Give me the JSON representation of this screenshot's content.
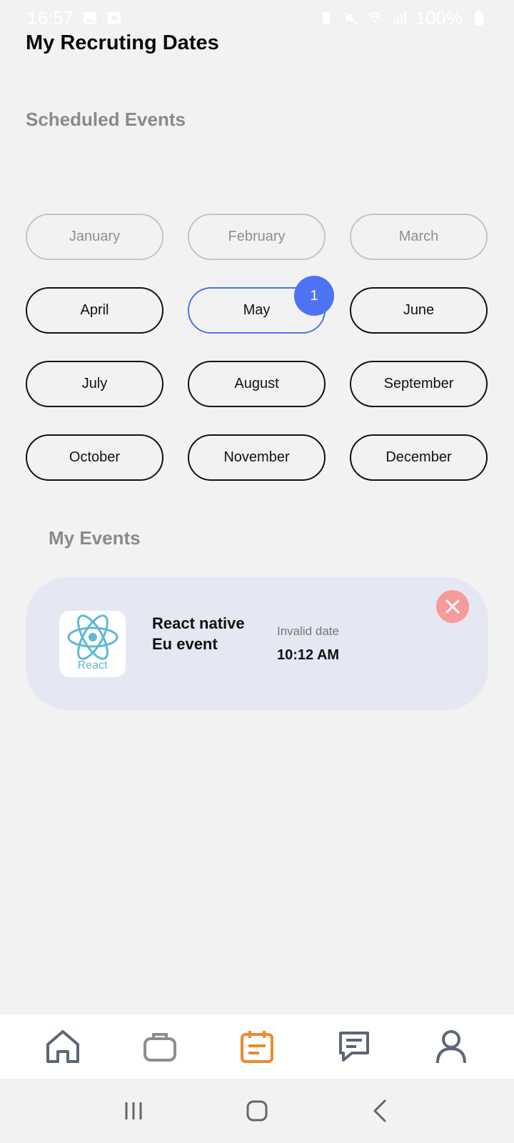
{
  "status_bar": {
    "time": "16:57",
    "battery": "100%",
    "icons": [
      "image-icon",
      "record-icon",
      "battery-saver-icon",
      "mute-icon",
      "wifi-icon",
      "signal-icon",
      "battery-icon"
    ]
  },
  "header": {
    "title": "My Recruting Dates"
  },
  "scheduled": {
    "title": "Scheduled Events",
    "months": [
      {
        "label": "January",
        "state": "disabled"
      },
      {
        "label": "February",
        "state": "disabled"
      },
      {
        "label": "March",
        "state": "disabled"
      },
      {
        "label": "April",
        "state": "active"
      },
      {
        "label": "May",
        "state": "selected",
        "badge": "1"
      },
      {
        "label": "June",
        "state": "active"
      },
      {
        "label": "July",
        "state": "active"
      },
      {
        "label": "August",
        "state": "active"
      },
      {
        "label": "September",
        "state": "active"
      },
      {
        "label": "October",
        "state": "active"
      },
      {
        "label": "November",
        "state": "active"
      },
      {
        "label": "December",
        "state": "active"
      }
    ]
  },
  "my_events": {
    "title": "My Events",
    "items": [
      {
        "logo_text": "React",
        "name": "React native Eu event",
        "date": "Invalid date",
        "time": "10:12 AM"
      }
    ]
  },
  "tab_bar": {
    "items": [
      {
        "icon": "home-icon",
        "active": false
      },
      {
        "icon": "briefcase-icon",
        "active": false
      },
      {
        "icon": "calendar-icon",
        "active": true
      },
      {
        "icon": "chat-icon",
        "active": false
      },
      {
        "icon": "profile-icon",
        "active": false
      }
    ]
  },
  "colors": {
    "accent": "#4e73f2",
    "active_tab": "#ec8a2f",
    "card_bg": "#e5e7f2",
    "remove": "#f79a9a"
  }
}
